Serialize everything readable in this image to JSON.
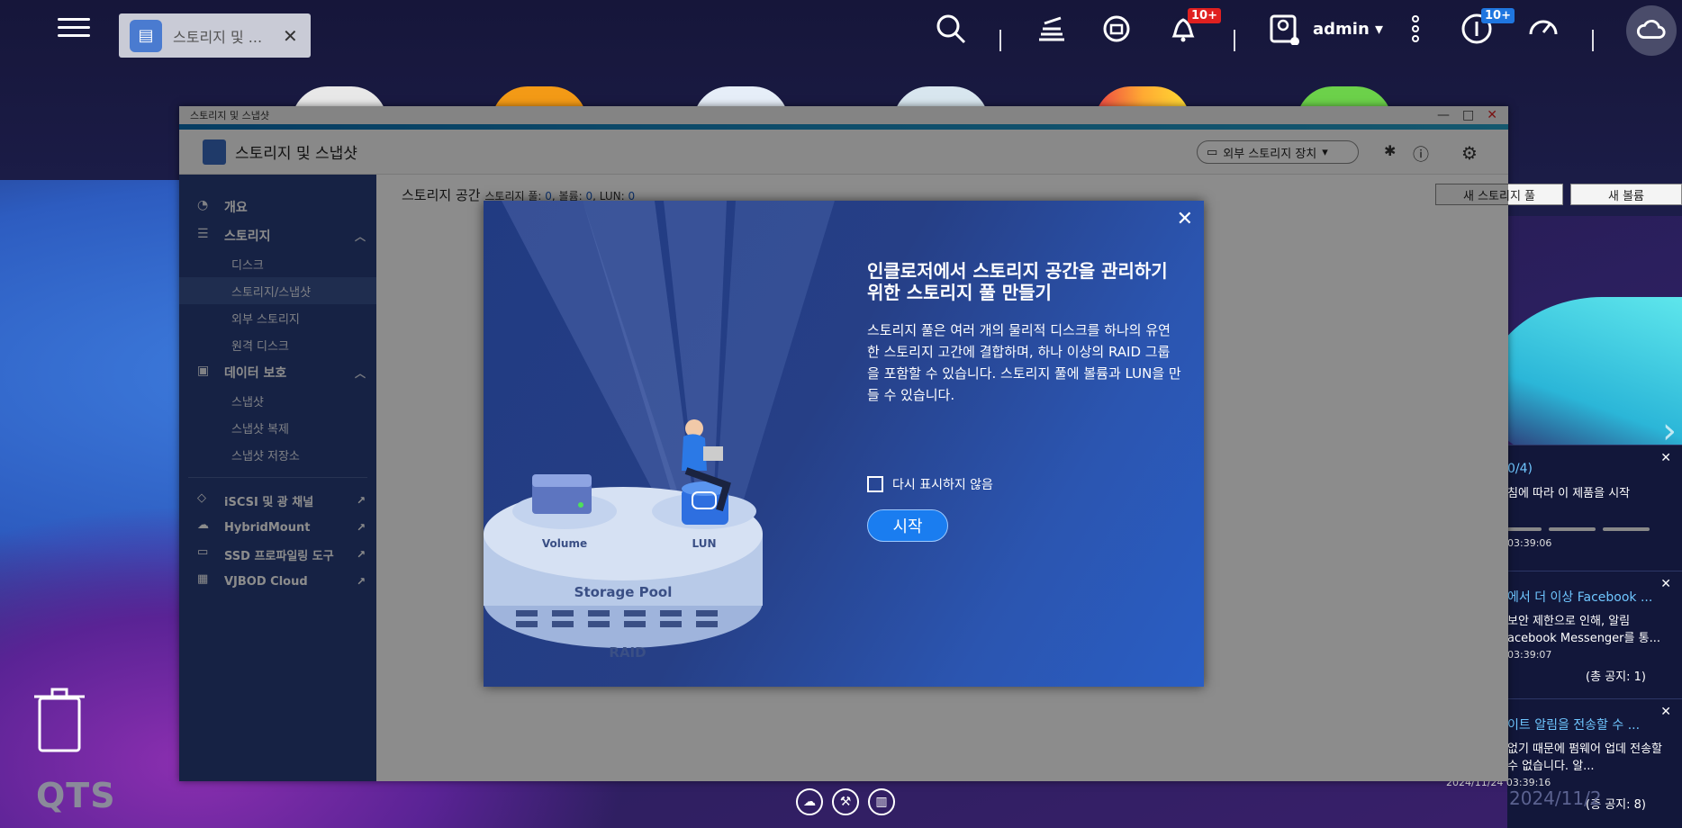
{
  "topbar": {
    "tab_label": "스토리지 및 ...",
    "admin_label": "admin",
    "badge_notifications": "10+",
    "badge_info": "10+"
  },
  "window": {
    "titlebar_text": "스토리지 및 스냅샷",
    "header_title": "스토리지 및 스냅샷",
    "external_select": "외부 스토리지 장치"
  },
  "sidebar": {
    "overview": "개요",
    "storage": "스토리지",
    "storage_items": [
      "디스크",
      "스토리지/스냅샷",
      "외부 스토리지",
      "원격 디스크"
    ],
    "data_protection": "데이터 보호",
    "protection_items": [
      "스냅샷",
      "스냅샷 복제",
      "스냅샷 저장소"
    ],
    "external_links": [
      "iSCSI 및 광 채널",
      "HybridMount",
      "SSD 프로파일링 도구",
      "VJBOD Cloud"
    ]
  },
  "content": {
    "title": "스토리지 공간",
    "pool_label": "스토리지 풀:",
    "pool_value": "0",
    "volume_label": ", 볼륨:",
    "volume_value": "0",
    "lun_label": ", LUN:",
    "lun_value": "0",
    "new_pool_button": "새 스토리지 풀",
    "new_volume_button": "새 볼륨"
  },
  "dialog": {
    "title": "인클로저에서 스토리지 공간을 관리하기 위한 스토리지 풀 만들기",
    "description": "스토리지 풀은 여러 개의 물리적 디스크를 하나의 유연한 스토리지 고간에 결합하며, 하나 이상의 RAID 그룹을 포함할 수 있습니다. 스토리지 풀에 볼륨과 LUN을 만들 수 있습니다.",
    "checkbox_label": "다시 표시하지 않음",
    "start_button": "시작",
    "illus_volume": "Volume",
    "illus_lun": "LUN",
    "illus_pool": "Storage Pool",
    "illus_raid": "RAID"
  },
  "notifications": [
    {
      "title": "0/4)",
      "body": "침에 따라 이 제품을 시작",
      "time": "03:39:06",
      "count": ""
    },
    {
      "title": "에서 더 이상 Facebook ...",
      "body": "보안 제한으로 인해, 알림 acebook Messenger를 통...",
      "time": "03:39:07",
      "count": "(총 공지: 1)"
    },
    {
      "title": "이트 알림을 전송할 수 ...",
      "body": "없기 때문에 펌웨어 업데 전송할 수 없습니다. 알...",
      "time": "2024/11/24 03:39:16",
      "count": "(총 공지: 8)"
    }
  ],
  "bottom": {
    "qts_label": "QTS",
    "clock_label": "2024/11/2"
  },
  "colors": {
    "sidebar": "#283f7d",
    "accent": "#1a7df0",
    "dialog": "#263f86"
  }
}
